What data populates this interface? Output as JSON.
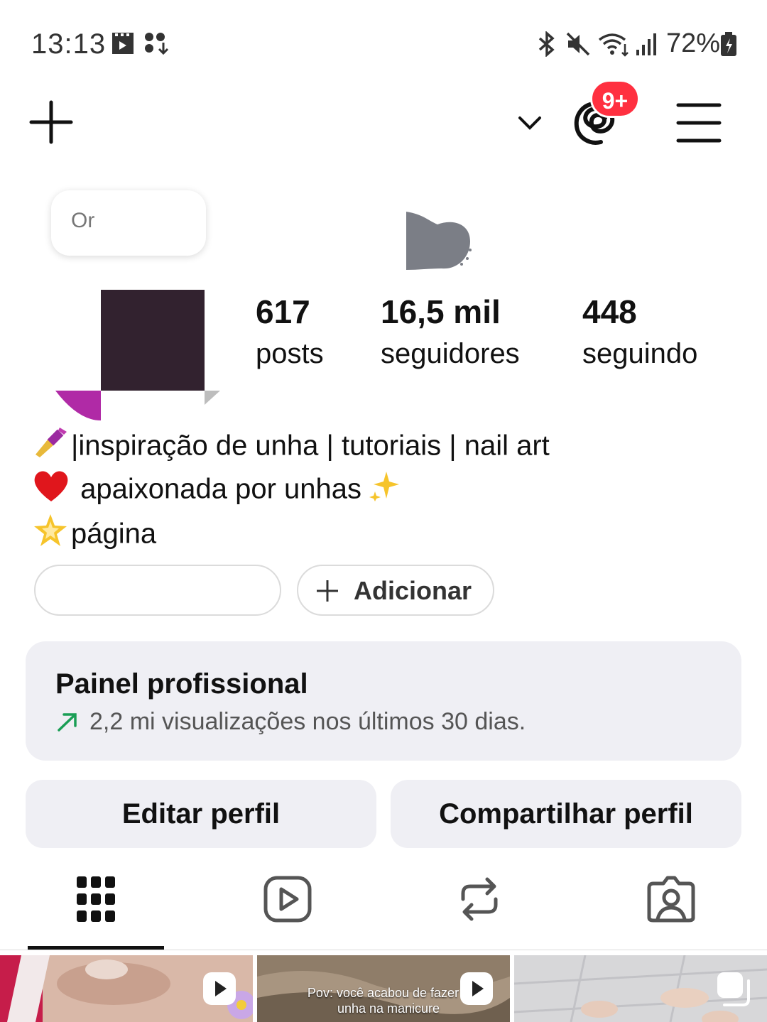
{
  "status_bar": {
    "time": "13:13",
    "battery_percent": "72%",
    "icons": [
      "media-icon",
      "download-icon",
      "bluetooth-icon",
      "mute-icon",
      "wifi-icon",
      "signal-icon",
      "battery-icon"
    ]
  },
  "topbar": {
    "notification_count": "9+",
    "icons": [
      "add-icon",
      "chevron-down-icon",
      "threads-icon",
      "menu-icon"
    ]
  },
  "profile": {
    "note_text": "Or",
    "stats": [
      {
        "value": "617",
        "label": "posts"
      },
      {
        "value": "16,5 mil",
        "label": "seguidores"
      },
      {
        "value": "448",
        "label": "seguindo"
      }
    ],
    "bio": [
      {
        "emoji": "nail-polish-icon",
        "text": "|inspiração de unha | tutoriais | nail art"
      },
      {
        "emoji": "heart-icon",
        "text": "apaixonada por unhas"
      },
      {
        "emoji": "star-icon",
        "text": "página"
      }
    ]
  },
  "chips": {
    "add_label": "Adicionar"
  },
  "dashboard": {
    "title": "Painel profissional",
    "subtitle": "2,2 mi visualizações nos últimos 30 dias."
  },
  "actions": {
    "edit": "Editar perfil",
    "share": "Compartilhar perfil"
  },
  "tabs": [
    "grid-icon",
    "reels-icon",
    "reposts-icon",
    "tagged-icon"
  ],
  "grid": {
    "posts": [
      {
        "type": "reel",
        "caption": ""
      },
      {
        "type": "reel",
        "caption": "Pov: você acabou de fazer a unha na manicure"
      },
      {
        "type": "carousel",
        "caption": ""
      }
    ]
  },
  "colors": {
    "accent_badge": "#ff3040",
    "button_bg": "#efeff4",
    "trend_green": "#1a9e55"
  }
}
